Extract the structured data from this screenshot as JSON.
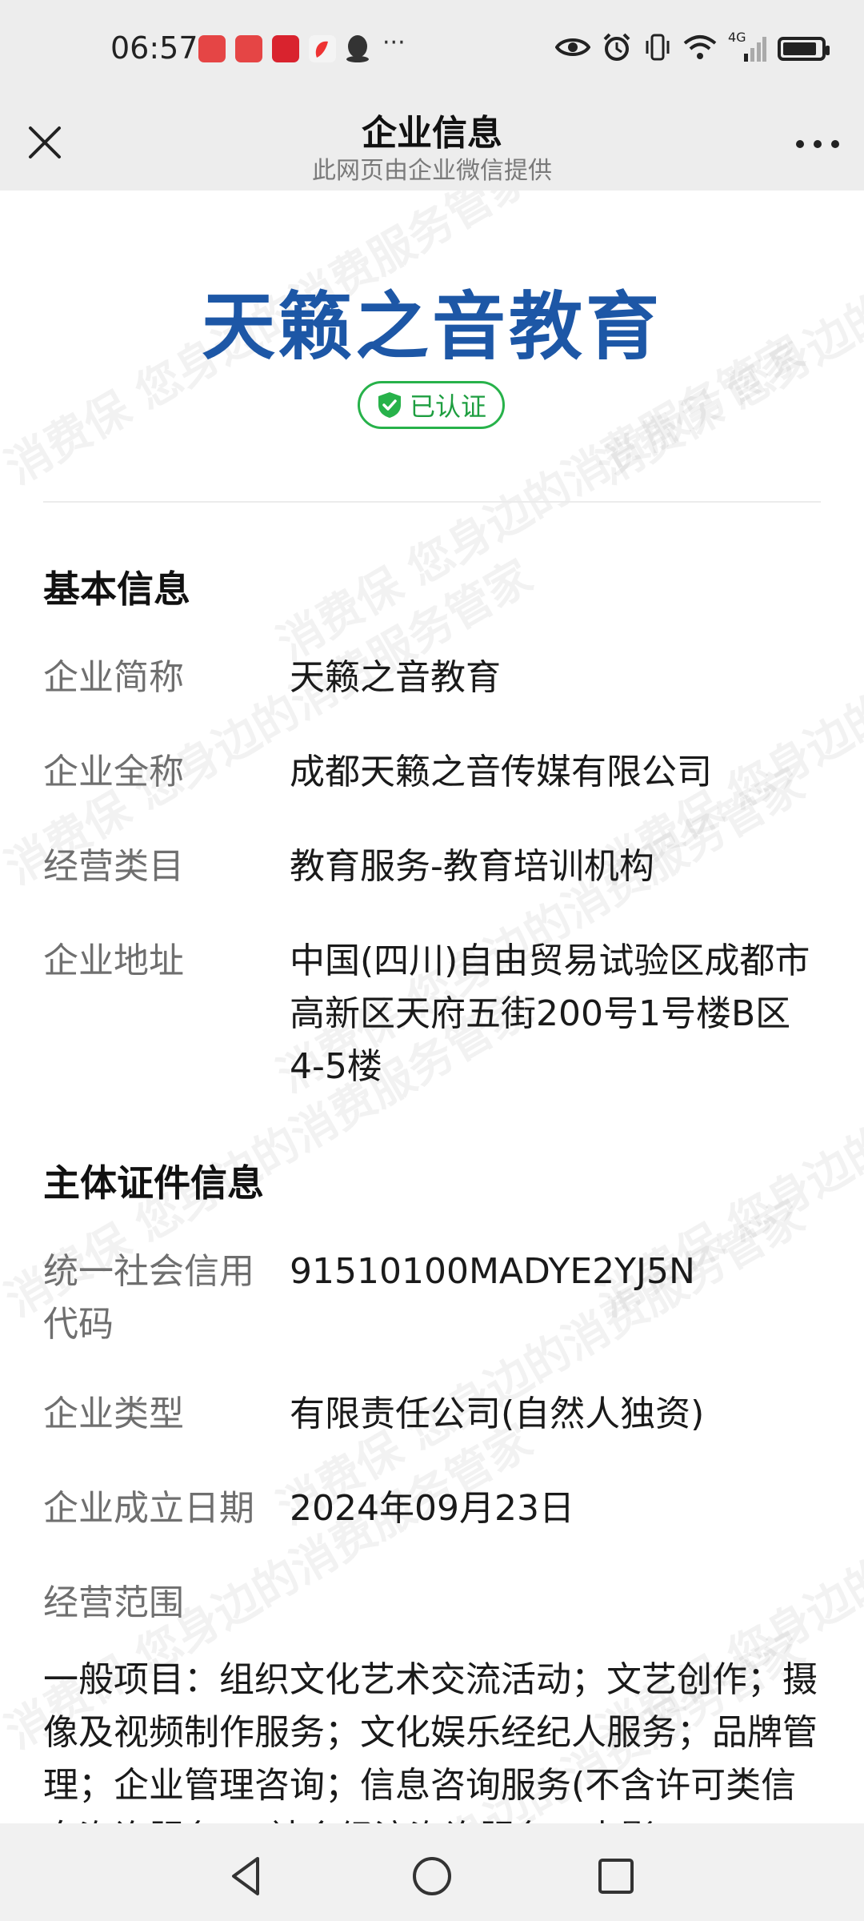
{
  "status_bar": {
    "time": "06:57",
    "notification_icons": [
      "huawei-app-icon",
      "huawei-app-icon",
      "app-icon",
      "app-icon",
      "qq-icon"
    ],
    "more_indicator": "···",
    "network_label": "4G",
    "battery_level": 0.9
  },
  "header": {
    "title": "企业信息",
    "subtitle": "此网页由企业微信提供"
  },
  "organization": {
    "name": "天籁之音教育",
    "verified_label": "已认证"
  },
  "basic_info": {
    "title": "基本信息",
    "rows": [
      {
        "label": "企业简称",
        "value": "天籁之音教育"
      },
      {
        "label": "企业全称",
        "value": "成都天籁之音传媒有限公司"
      },
      {
        "label": "经营类目",
        "value": "教育服务-教育培训机构"
      },
      {
        "label": "企业地址",
        "value": "中国(四川)自由贸易试验区成都市高新区天府五街200号1号楼B区4-5楼"
      }
    ]
  },
  "certificate_info": {
    "title": "主体证件信息",
    "rows": [
      {
        "label": "统一社会信用代码",
        "value": "91510100MADYE2YJ5N"
      },
      {
        "label": "企业类型",
        "value": "有限责任公司(自然人独资)"
      },
      {
        "label": "企业成立日期",
        "value": "2024年09月23日"
      }
    ],
    "scope_label": "经营范围",
    "scope_text": "一般项目：组织文化艺术交流活动；文艺创作；摄像及视频制作服务；文化娱乐经纪人服务；品牌管理；企业管理咨询；信息咨询服务(不含许可类信息咨询服务)；社会经济咨询服务；电影"
  },
  "watermark": "消费保 您身边的消费服务管家",
  "colors": {
    "brand_blue": "#1d57a6",
    "verified_green": "#27b24a",
    "header_bg": "#ededed"
  }
}
